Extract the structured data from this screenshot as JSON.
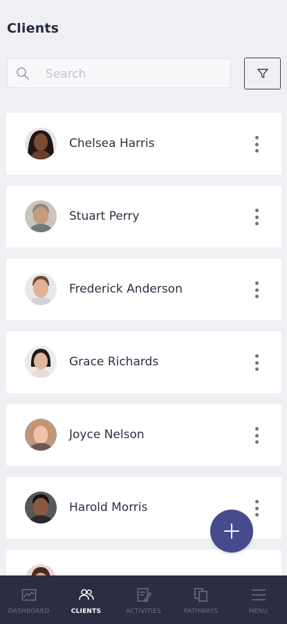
{
  "header": {
    "title": "Clients"
  },
  "search": {
    "placeholder": "Search",
    "value": ""
  },
  "filter": {
    "icon": "filter-icon"
  },
  "clients": [
    {
      "name": "Chelsea Harris",
      "avatar": "avatar-photo"
    },
    {
      "name": "Stuart Perry",
      "avatar": "avatar-photo"
    },
    {
      "name": "Frederick Anderson",
      "avatar": "avatar-photo"
    },
    {
      "name": "Grace Richards",
      "avatar": "avatar-photo"
    },
    {
      "name": "Joyce Nelson",
      "avatar": "avatar-photo"
    },
    {
      "name": "Harold Morris",
      "avatar": "avatar-photo"
    },
    {
      "name": "",
      "avatar": "avatar-photo"
    }
  ],
  "fab": {
    "icon": "plus-icon"
  },
  "bottom_nav": {
    "items": [
      {
        "label": "DASHBOARD",
        "icon": "dashboard-icon",
        "active": false
      },
      {
        "label": "CLIENTS",
        "icon": "clients-icon",
        "active": true
      },
      {
        "label": "ACTIVITIES",
        "icon": "activities-icon",
        "active": false
      },
      {
        "label": "PATHWAYS",
        "icon": "pathways-icon",
        "active": false
      },
      {
        "label": "MENU",
        "icon": "menu-icon",
        "active": false
      }
    ]
  },
  "colors": {
    "background": "#eff0f4",
    "card": "#ffffff",
    "accent": "#484a8e",
    "nav_background": "#2c2d40",
    "nav_inactive": "#6e7083",
    "nav_active": "#ffffff"
  }
}
